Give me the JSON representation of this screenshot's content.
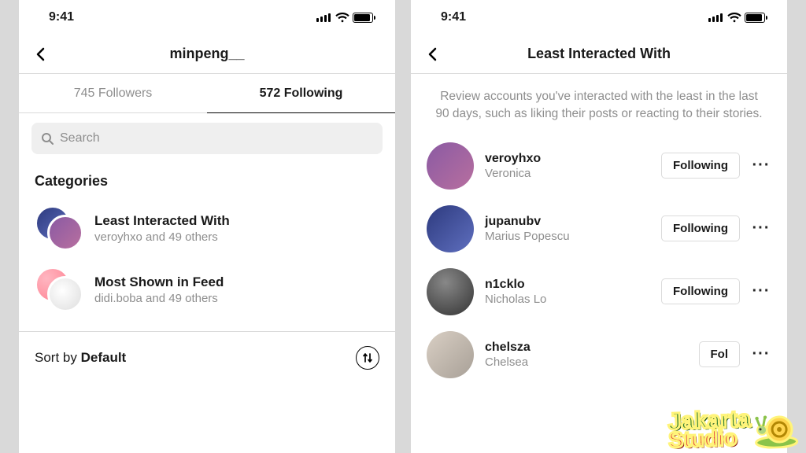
{
  "status_bar": {
    "time": "9:41"
  },
  "left": {
    "header": {
      "title": "minpeng__"
    },
    "tabs": {
      "followers": "745 Followers",
      "following": "572 Following"
    },
    "search": {
      "placeholder": "Search"
    },
    "categories": {
      "heading": "Categories",
      "items": [
        {
          "title": "Least Interacted With",
          "subtitle": "veroyhxo and 49 others"
        },
        {
          "title": "Most Shown in Feed",
          "subtitle": "didi.boba and 49 others"
        }
      ]
    },
    "sort": {
      "prefix": "Sort by ",
      "value": "Default"
    }
  },
  "right": {
    "header": {
      "title": "Least Interacted With"
    },
    "description": "Review accounts you've interacted with the least in the last 90 days, such as liking their posts or reacting to their stories.",
    "users": [
      {
        "username": "veroyhxo",
        "name": "Veronica",
        "button": "Following"
      },
      {
        "username": "jupanubv",
        "name": "Marius Popescu",
        "button": "Following"
      },
      {
        "username": "n1cklo",
        "name": "Nicholas Lo",
        "button": "Following"
      },
      {
        "username": "chelsza",
        "name": "Chelsea",
        "button": "Fol"
      }
    ]
  },
  "watermark": {
    "line1": "Jakarta",
    "line2": "Studio"
  }
}
